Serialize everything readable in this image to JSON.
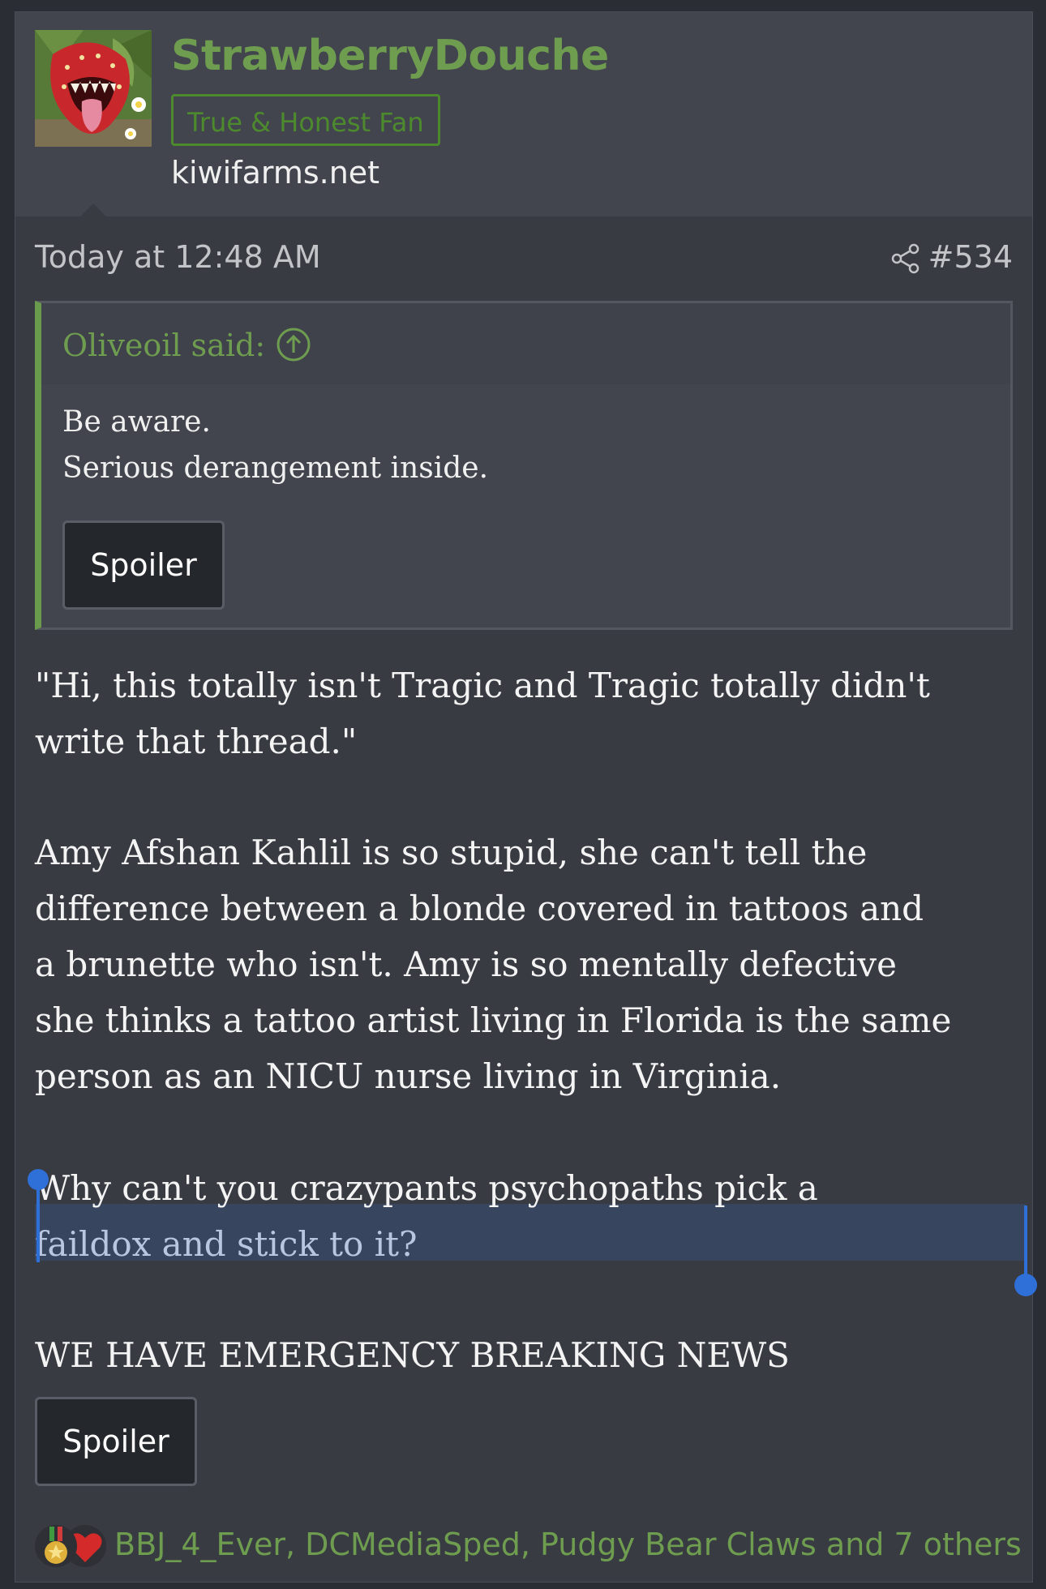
{
  "post": {
    "username": "StrawberryDouche",
    "user_title": "True & Honest Fan",
    "user_site": "kiwifarms.net",
    "timestamp": "Today at 12:48 AM",
    "post_number": "#534",
    "avatar_icon": "strawberry-monster-avatar"
  },
  "quote": {
    "author": "Oliveoil said:",
    "lines": [
      "Be aware.",
      "Serious derangement inside."
    ],
    "spoiler_label": "Spoiler"
  },
  "body": {
    "paragraph1": [
      "\"Hi, this totally isn't Tragic and Tragic totally didn't",
      "write that thread.\""
    ],
    "paragraph2": [
      "Amy Afshan Kahlil is so stupid, she can't tell the",
      "difference between a blonde covered in tattoos and",
      "a brunette who isn't. Amy is so mentally defective",
      "she thinks a tattoo artist living in Florida is the same",
      "person as an NICU nurse living in Virginia."
    ],
    "paragraph3": [
      "Why can't you crazypants psychopaths pick a",
      "faildox and stick to it?"
    ],
    "paragraph4": "WE HAVE EMERGENCY BREAKING NEWS",
    "spoiler_label": "Spoiler"
  },
  "reactions": {
    "text": "BBJ_4_Ever, DCMediaSped, Pudgy Bear Claws and 7 others",
    "icons": [
      "medal-icon",
      "heart-icon"
    ]
  },
  "colors": {
    "accent_green": "#6f9d50",
    "title_green": "#4d8a2d",
    "selection": "#37455f",
    "selection_handle": "#2f6fd8"
  }
}
